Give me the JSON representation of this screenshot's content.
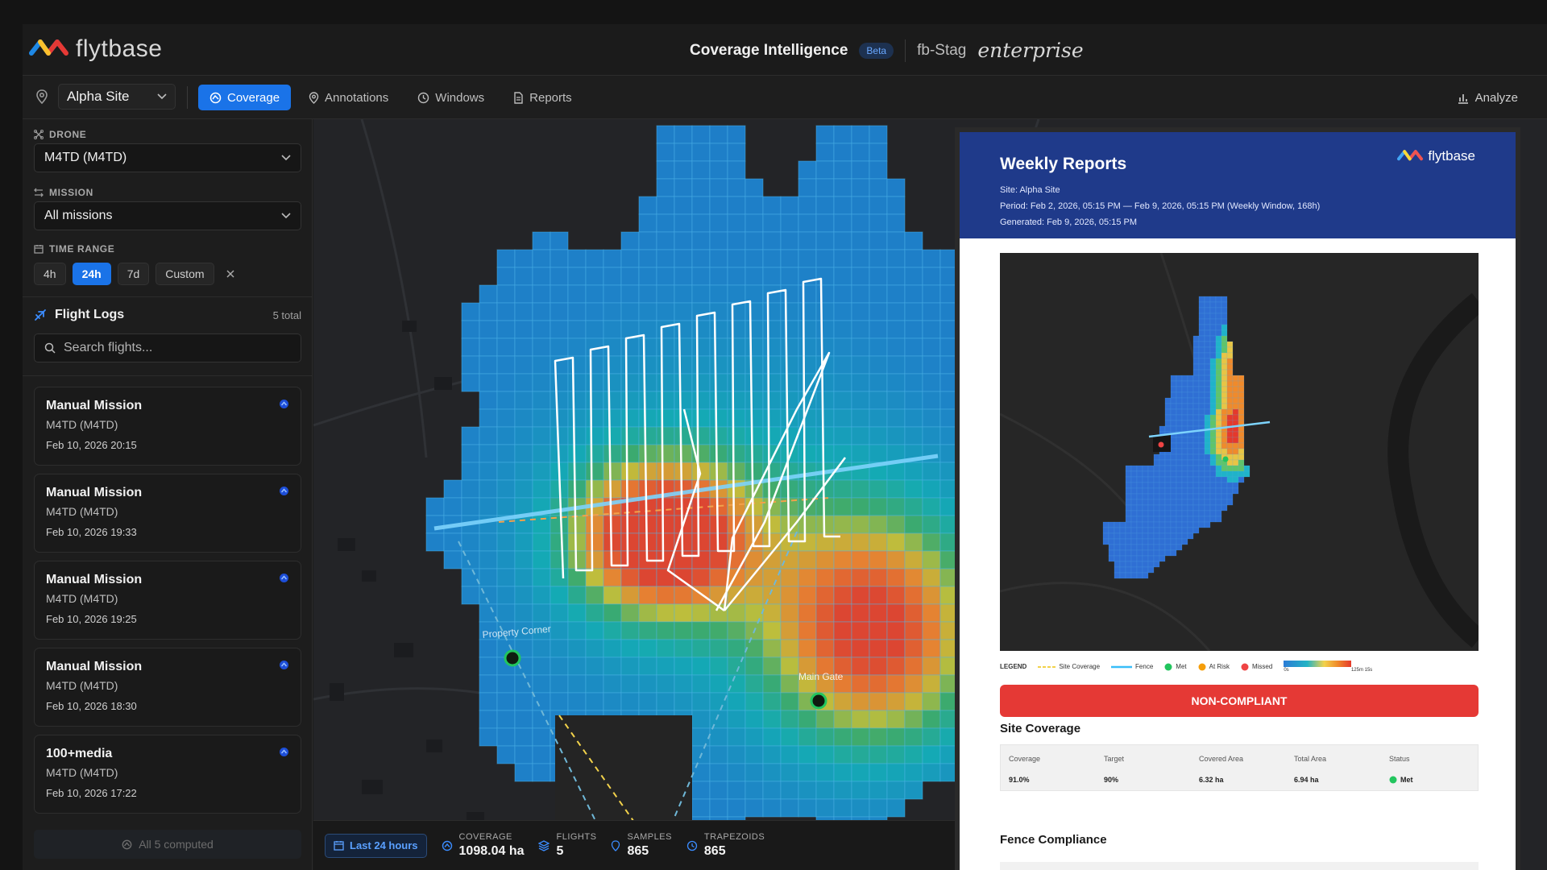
{
  "header": {
    "logo_text": "flytbase",
    "app_title": "Coverage Intelligence",
    "beta_label": "Beta",
    "org_name": "fb-Stag",
    "edition": "enterprise"
  },
  "toolbar": {
    "site": "Alpha Site",
    "tabs": [
      {
        "label": "Coverage",
        "icon": "coverage-icon"
      },
      {
        "label": "Annotations",
        "icon": "pin-icon"
      },
      {
        "label": "Windows",
        "icon": "clock-icon"
      },
      {
        "label": "Reports",
        "icon": "document-icon"
      }
    ],
    "analyze_label": "Analyze"
  },
  "sidebar": {
    "drone_label": "DRONE",
    "drone_value": "M4TD (M4TD)",
    "mission_label": "MISSION",
    "mission_value": "All missions",
    "time_range_label": "TIME RANGE",
    "time_options": [
      "4h",
      "24h",
      "7d",
      "Custom"
    ],
    "selected_time": "24h",
    "flight_logs_title": "Flight Logs",
    "flight_logs_count": "5 total",
    "search_placeholder": "Search flights...",
    "flights": [
      {
        "title": "Manual Mission",
        "drone": "M4TD (M4TD)",
        "date": "Feb 10, 2026 20:15"
      },
      {
        "title": "Manual Mission",
        "drone": "M4TD (M4TD)",
        "date": "Feb 10, 2026 19:33"
      },
      {
        "title": "Manual Mission",
        "drone": "M4TD (M4TD)",
        "date": "Feb 10, 2026 19:25"
      },
      {
        "title": "Manual Mission",
        "drone": "M4TD (M4TD)",
        "date": "Feb 10, 2026 18:30"
      },
      {
        "title": "100+media",
        "drone": "M4TD (M4TD)",
        "date": "Feb 10, 2026 17:22"
      }
    ],
    "computed_label": "All 5 computed"
  },
  "map": {
    "labels": {
      "property_corner": "Property Corner",
      "main_gate": "Main Gate"
    }
  },
  "stats": {
    "time_filter": "Last 24 hours",
    "coverage_label": "COVERAGE",
    "coverage_value": "1098.04 ha",
    "flights_label": "FLIGHTS",
    "flights_value": "5",
    "samples_label": "SAMPLES",
    "samples_value": "865",
    "trapezoids_label": "TRAPEZOIDS",
    "trapezoids_value": "865"
  },
  "report": {
    "title": "Weekly Reports",
    "logo_text": "flytbase",
    "site": "Site: Alpha Site",
    "period": "Period: Feb 2, 2026, 05:15 PM — Feb 9, 2026, 05:15 PM (Weekly Window, 168h)",
    "generated": "Generated: Feb 9, 2026, 05:15 PM",
    "legend": {
      "title": "LEGEND",
      "site_coverage": "Site Coverage",
      "fence": "Fence",
      "met": "Met",
      "at_risk": "At Risk",
      "missed": "Missed",
      "scale_min": "0s",
      "scale_max": "125m 15s"
    },
    "status_banner": "NON-COMPLIANT",
    "site_coverage_title": "Site Coverage",
    "site_coverage_table": {
      "headers": [
        "Coverage",
        "Target",
        "Covered Area",
        "Total Area",
        "Status"
      ],
      "values": [
        "91.0%",
        "90%",
        "6.32 ha",
        "6.94 ha",
        "Met"
      ]
    },
    "fence_title": "Fence Compliance"
  },
  "colors": {
    "accent": "#1a73e8",
    "report_header": "#1f3a8a",
    "non_compliant": "#e53935",
    "met": "#22c55e",
    "at_risk": "#f59e0b",
    "missed": "#ef4444"
  }
}
